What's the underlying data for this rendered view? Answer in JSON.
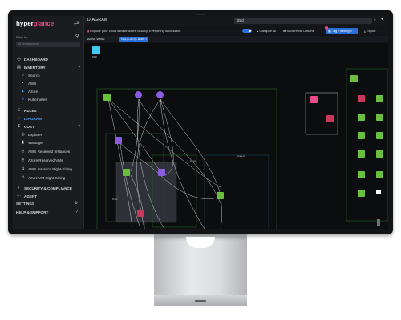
{
  "app": {
    "logo_a": "hyper",
    "logo_b": "glance",
    "page_title": "DIAGRAM"
  },
  "sidebar": {
    "filter_label": "Filter by",
    "search_placeholder": "All Environments",
    "items": [
      {
        "icon": "dashboard-icon",
        "glyph": "◷",
        "label": "DASHBOARD"
      },
      {
        "icon": "inventory-icon",
        "glyph": "▤",
        "label": "INVENTORY"
      },
      {
        "icon": "search-icon",
        "glyph": "⌕",
        "label": "Search"
      },
      {
        "icon": "aws-icon",
        "glyph": "▪",
        "label": "AWS"
      },
      {
        "icon": "azure-icon",
        "glyph": "▴",
        "label": "Azure"
      },
      {
        "icon": "kubernetes-icon",
        "glyph": "✲",
        "label": "Kubernetes"
      },
      {
        "icon": "rules-icon",
        "glyph": "⚟",
        "label": "RULES"
      },
      {
        "icon": "diagram-icon",
        "glyph": "⑂",
        "label": "DIAGRAM"
      },
      {
        "icon": "cost-icon",
        "glyph": "$",
        "label": "COST"
      },
      {
        "icon": "explorer-icon",
        "glyph": "◎",
        "label": "Explorer"
      },
      {
        "icon": "wastage-icon",
        "glyph": "▮",
        "label": "Wastage"
      },
      {
        "icon": "aws-reserved-icon",
        "glyph": "⊵",
        "label": "AWS Reserved Instances"
      },
      {
        "icon": "azure-reserved-icon",
        "glyph": "⊵",
        "label": "Azure Reserved VMs"
      },
      {
        "icon": "aws-rightsizing-icon",
        "glyph": "⇅",
        "label": "AWS Instance Right-Sizing"
      },
      {
        "icon": "azure-rightsizing-icon",
        "glyph": "⇅",
        "label": "Azure VM Right-Sizing"
      },
      {
        "icon": "security-icon",
        "glyph": "◐",
        "label": "SECURITY & COMPLIANCE"
      },
      {
        "icon": "agent-icon",
        "glyph": "···",
        "label": "AGENT"
      },
      {
        "icon": "settings-icon",
        "glyph": "",
        "label": "SETTINGS"
      },
      {
        "icon": "help-icon",
        "glyph": "",
        "label": "HELP & SUPPORT"
      }
    ]
  },
  "topbar": {
    "search_value": "dmd"
  },
  "toolbar": {
    "explore_text": "Explore your cloud infrastructure visually. Everything is clickable.",
    "collapse_all": "Collapse All",
    "show_hide": "Show/Hide Options",
    "tag_filtering": "Tag Filtering",
    "export": "Export"
  },
  "views": {
    "label": "Active views:",
    "chip": "Tags (1 of ≈≈) - DMD7 ×"
  },
  "colors": {
    "accent_pink": "#e84c8b",
    "blue": "#2a6fd6",
    "aws_green": "#6abf3f",
    "purple": "#8a5de0"
  }
}
